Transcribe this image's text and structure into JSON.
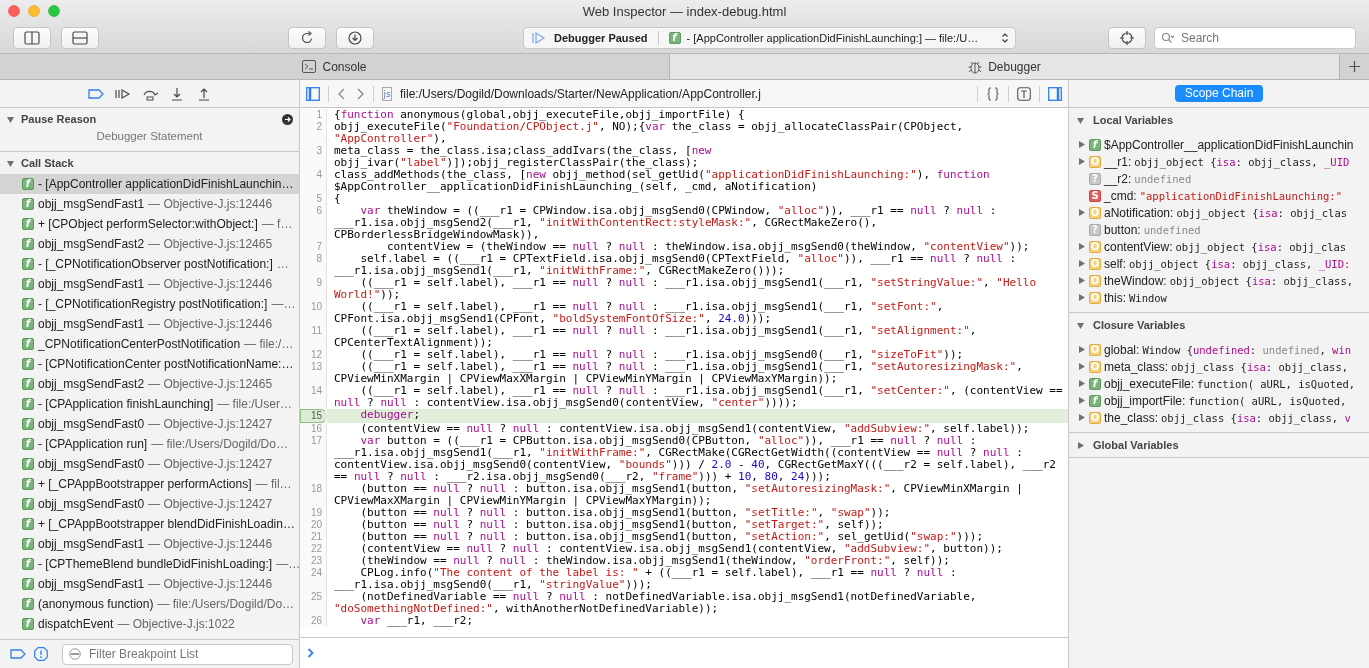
{
  "window": {
    "title": "Web Inspector — index-debug.html"
  },
  "toolbar": {
    "status": "Debugger Paused",
    "frame_icon": "f",
    "frame": "- [AppController applicationDidFinishLaunching:] — file:/U…",
    "search": {
      "placeholder": "Search"
    }
  },
  "tabs": [
    {
      "label": "Console",
      "kind": "console",
      "selected": false
    },
    {
      "label": "Debugger",
      "kind": "debugger",
      "selected": true
    }
  ],
  "sidebar": {
    "sections": [
      {
        "title": "Pause Reason",
        "kind": "reason",
        "expanded": true,
        "text": "Debugger Statement"
      },
      {
        "title": "Call Stack",
        "kind": "stack",
        "expanded": true,
        "items": [
          {
            "icon": "f",
            "name": "- [AppController applicationDidFinishLaunchin…",
            "selected": true
          },
          {
            "icon": "f",
            "name": "objj_msgSendFast1",
            "location": "— Objective-J.js:12446",
            "selected": false
          },
          {
            "icon": "f",
            "name": "+ [CPObject performSelector:withObject:]",
            "location": "— f…",
            "selected": false
          },
          {
            "icon": "f",
            "name": "objj_msgSendFast2",
            "location": "— Objective-J.js:12465",
            "selected": false
          },
          {
            "icon": "f",
            "name": "- [_CPNotificationObserver postNotification:]",
            "location": "…",
            "selected": false
          },
          {
            "icon": "f",
            "name": "objj_msgSendFast1",
            "location": "— Objective-J.js:12446",
            "selected": false
          },
          {
            "icon": "f",
            "name": "- [_CPNotificationRegistry postNotification:]",
            "location": "—…",
            "selected": false
          },
          {
            "icon": "f",
            "name": "objj_msgSendFast1",
            "location": "— Objective-J.js:12446",
            "selected": false
          },
          {
            "icon": "f",
            "name": "_CPNotificationCenterPostNotification",
            "location": "— file:/…",
            "selected": false
          },
          {
            "icon": "f",
            "name": "- [CPNotificationCenter postNotificationName:…",
            "selected": false
          },
          {
            "icon": "f",
            "name": "objj_msgSendFast2",
            "location": "— Objective-J.js:12465",
            "selected": false
          },
          {
            "icon": "f",
            "name": "- [CPApplication finishLaunching]",
            "location": "— file:/User…",
            "selected": false
          },
          {
            "icon": "f",
            "name": "objj_msgSendFast0",
            "location": "— Objective-J.js:12427",
            "selected": false
          },
          {
            "icon": "f",
            "name": "- [CPApplication run]",
            "location": "— file:/Users/Dogild/Do…",
            "selected": false
          },
          {
            "icon": "f",
            "name": "objj_msgSendFast0",
            "location": "— Objective-J.js:12427",
            "selected": false
          },
          {
            "icon": "f",
            "name": "+ [_CPAppBootstrapper performActions]",
            "location": "— fil…",
            "selected": false
          },
          {
            "icon": "f",
            "name": "objj_msgSendFast0",
            "location": "— Objective-J.js:12427",
            "selected": false
          },
          {
            "icon": "f",
            "name": "+ [_CPAppBootstrapper blendDidFinishLoadin…",
            "selected": false
          },
          {
            "icon": "f",
            "name": "objj_msgSendFast1",
            "location": "— Objective-J.js:12446",
            "selected": false
          },
          {
            "icon": "f",
            "name": "- [CPThemeBlend bundleDidFinishLoading:]",
            "location": "—…",
            "selected": false
          },
          {
            "icon": "f",
            "name": "objj_msgSendFast1",
            "location": "— Objective-J.js:12446",
            "selected": false
          },
          {
            "icon": "f",
            "name": "(anonymous function)",
            "location": "— file:/Users/Dogild/Do…",
            "selected": false
          },
          {
            "icon": "f",
            "name": "dispatchEvent",
            "location": "— Objective-J.js:1022",
            "selected": false
          }
        ]
      }
    ],
    "filter": {
      "placeholder": "Filter Breakpoint List"
    }
  },
  "editor": {
    "path": "file:/Users/Dogild/Downloads/Starter/NewApplication/AppController.j",
    "file_icon": "js",
    "lines": [
      {
        "number": "1",
        "current": false,
        "tokens": [
          {
            "kind": "plain",
            "text": "{"
          },
          {
            "kind": "keyword",
            "text": "function"
          },
          {
            "kind": "plain",
            "text": " anonymous(global,objj_executeFile,objj_importFile) {"
          }
        ]
      },
      {
        "number": "2",
        "current": false,
        "tokens": [
          {
            "kind": "plain",
            "text": "objj_executeFile("
          },
          {
            "kind": "string",
            "text": "\"Foundation/CPObject.j\""
          },
          {
            "kind": "plain",
            "text": ", NO);{"
          },
          {
            "kind": "keyword",
            "text": "var"
          },
          {
            "kind": "plain",
            "text": " the_class = objj_allocateClassPair(CPObject, "
          },
          {
            "kind": "string",
            "text": "\"AppController\""
          },
          {
            "kind": "plain",
            "text": "),"
          }
        ]
      },
      {
        "number": "3",
        "current": false,
        "tokens": [
          {
            "kind": "plain",
            "text": "meta_class = the_class.isa;class_addIvars(the_class, ["
          },
          {
            "kind": "keyword",
            "text": "new"
          },
          {
            "kind": "plain",
            "text": " objj_ivar("
          },
          {
            "kind": "string",
            "text": "\"label\""
          },
          {
            "kind": "plain",
            "text": ")]);objj_registerClassPair(the_class);"
          }
        ]
      },
      {
        "number": "4",
        "current": false,
        "tokens": [
          {
            "kind": "plain",
            "text": "class_addMethods(the_class, ["
          },
          {
            "kind": "keyword",
            "text": "new"
          },
          {
            "kind": "plain",
            "text": " objj_method(sel_getUid("
          },
          {
            "kind": "string",
            "text": "\"applicationDidFinishLaunching:\""
          },
          {
            "kind": "plain",
            "text": "), "
          },
          {
            "kind": "keyword",
            "text": "function"
          },
          {
            "kind": "plain",
            "text": " $AppController__applicationDidFinishLaunching_(self, _cmd, aNotification)"
          }
        ]
      },
      {
        "number": "5",
        "current": false,
        "tokens": [
          {
            "kind": "plain",
            "text": "{"
          }
        ]
      },
      {
        "number": "6",
        "current": false,
        "tokens": [
          {
            "kind": "keyword",
            "text": "    var"
          },
          {
            "kind": "plain",
            "text": " theWindow = ((___r1 = CPWindow.isa.objj_msgSend0(CPWindow, "
          },
          {
            "kind": "string",
            "text": "\"alloc\""
          },
          {
            "kind": "plain",
            "text": ")), ___r1 == "
          },
          {
            "kind": "keyword",
            "text": "null"
          },
          {
            "kind": "plain",
            "text": " ? "
          },
          {
            "kind": "keyword",
            "text": "null"
          },
          {
            "kind": "plain",
            "text": " : ___r1.isa.objj_msgSend2(___r1, "
          },
          {
            "kind": "string",
            "text": "\"initWithContentRect:styleMask:\""
          },
          {
            "kind": "plain",
            "text": ", CGRectMakeZero(), CPBorderlessBridgeWindowMask)),"
          }
        ]
      },
      {
        "number": "7",
        "current": false,
        "tokens": [
          {
            "kind": "plain",
            "text": "        contentView = (theWindow == "
          },
          {
            "kind": "keyword",
            "text": "null"
          },
          {
            "kind": "plain",
            "text": " ? "
          },
          {
            "kind": "keyword",
            "text": "null"
          },
          {
            "kind": "plain",
            "text": " : theWindow.isa.objj_msgSend0(theWindow, "
          },
          {
            "kind": "string",
            "text": "\"contentView\""
          },
          {
            "kind": "plain",
            "text": "));"
          }
        ]
      },
      {
        "number": "8",
        "current": false,
        "tokens": [
          {
            "kind": "plain",
            "text": "    self.label = ((___r1 = CPTextField.isa.objj_msgSend0(CPTextField, "
          },
          {
            "kind": "string",
            "text": "\"alloc\""
          },
          {
            "kind": "plain",
            "text": ")), ___r1 == "
          },
          {
            "kind": "keyword",
            "text": "null"
          },
          {
            "kind": "plain",
            "text": " ? "
          },
          {
            "kind": "keyword",
            "text": "null"
          },
          {
            "kind": "plain",
            "text": " : ___r1.isa.objj_msgSend1(___r1, "
          },
          {
            "kind": "string",
            "text": "\"initWithFrame:\""
          },
          {
            "kind": "plain",
            "text": ", CGRectMakeZero()));"
          }
        ]
      },
      {
        "number": "9",
        "current": false,
        "tokens": [
          {
            "kind": "plain",
            "text": "    ((___r1 = self.label), ___r1 == "
          },
          {
            "kind": "keyword",
            "text": "null"
          },
          {
            "kind": "plain",
            "text": " ? "
          },
          {
            "kind": "keyword",
            "text": "null"
          },
          {
            "kind": "plain",
            "text": " : ___r1.isa.objj_msgSend1(___r1, "
          },
          {
            "kind": "string",
            "text": "\"setStringValue:\""
          },
          {
            "kind": "plain",
            "text": ", "
          },
          {
            "kind": "string",
            "text": "\"Hello World!\""
          },
          {
            "kind": "plain",
            "text": "));"
          }
        ]
      },
      {
        "number": "10",
        "current": false,
        "tokens": [
          {
            "kind": "plain",
            "text": "    ((___r1 = self.label), ___r1 == "
          },
          {
            "kind": "keyword",
            "text": "null"
          },
          {
            "kind": "plain",
            "text": " ? "
          },
          {
            "kind": "keyword",
            "text": "null"
          },
          {
            "kind": "plain",
            "text": " : ___r1.isa.objj_msgSend1(___r1, "
          },
          {
            "kind": "string",
            "text": "\"setFont:\""
          },
          {
            "kind": "plain",
            "text": ", CPFont.isa.objj_msgSend1(CPFont, "
          },
          {
            "kind": "string",
            "text": "\"boldSystemFontOfSize:\""
          },
          {
            "kind": "plain",
            "text": ", "
          },
          {
            "kind": "number",
            "text": "24.0"
          },
          {
            "kind": "plain",
            "text": ")));"
          }
        ]
      },
      {
        "number": "11",
        "current": false,
        "tokens": [
          {
            "kind": "plain",
            "text": "    ((___r1 = self.label), ___r1 == "
          },
          {
            "kind": "keyword",
            "text": "null"
          },
          {
            "kind": "plain",
            "text": " ? "
          },
          {
            "kind": "keyword",
            "text": "null"
          },
          {
            "kind": "plain",
            "text": " : ___r1.isa.objj_msgSend1(___r1, "
          },
          {
            "kind": "string",
            "text": "\"setAlignment:\""
          },
          {
            "kind": "plain",
            "text": ", CPCenterTextAlignment));"
          }
        ]
      },
      {
        "number": "12",
        "current": false,
        "tokens": [
          {
            "kind": "plain",
            "text": "    ((___r1 = self.label), ___r1 == "
          },
          {
            "kind": "keyword",
            "text": "null"
          },
          {
            "kind": "plain",
            "text": " ? "
          },
          {
            "kind": "keyword",
            "text": "null"
          },
          {
            "kind": "plain",
            "text": " : ___r1.isa.objj_msgSend0(___r1, "
          },
          {
            "kind": "string",
            "text": "\"sizeToFit\""
          },
          {
            "kind": "plain",
            "text": "));"
          }
        ]
      },
      {
        "number": "13",
        "current": false,
        "tokens": [
          {
            "kind": "plain",
            "text": "    ((___r1 = self.label), ___r1 == "
          },
          {
            "kind": "keyword",
            "text": "null"
          },
          {
            "kind": "plain",
            "text": " ? "
          },
          {
            "kind": "keyword",
            "text": "null"
          },
          {
            "kind": "plain",
            "text": " : ___r1.isa.objj_msgSend1(___r1, "
          },
          {
            "kind": "string",
            "text": "\"setAutoresizingMask:\""
          },
          {
            "kind": "plain",
            "text": ", CPViewMinXMargin | CPViewMaxXMargin | CPViewMinYMargin | CPViewMaxYMargin));"
          }
        ]
      },
      {
        "number": "14",
        "current": false,
        "tokens": [
          {
            "kind": "plain",
            "text": "    ((___r1 = self.label), ___r1 == "
          },
          {
            "kind": "keyword",
            "text": "null"
          },
          {
            "kind": "plain",
            "text": " ? "
          },
          {
            "kind": "keyword",
            "text": "null"
          },
          {
            "kind": "plain",
            "text": " : ___r1.isa.objj_msgSend1(___r1, "
          },
          {
            "kind": "string",
            "text": "\"setCenter:\""
          },
          {
            "kind": "plain",
            "text": ", (contentView == "
          },
          {
            "kind": "keyword",
            "text": "null"
          },
          {
            "kind": "plain",
            "text": " ? "
          },
          {
            "kind": "keyword",
            "text": "null"
          },
          {
            "kind": "plain",
            "text": " : contentView.isa.objj_msgSend0(contentView, "
          },
          {
            "kind": "string",
            "text": "\"center\""
          },
          {
            "kind": "plain",
            "text": "))));"
          }
        ]
      },
      {
        "number": "15",
        "current": true,
        "tokens": [
          {
            "kind": "keyword",
            "text": "    debugger"
          },
          {
            "kind": "plain",
            "text": ";"
          }
        ]
      },
      {
        "number": "16",
        "current": false,
        "tokens": [
          {
            "kind": "plain",
            "text": "    (contentView == "
          },
          {
            "kind": "keyword",
            "text": "null"
          },
          {
            "kind": "plain",
            "text": " ? "
          },
          {
            "kind": "keyword",
            "text": "null"
          },
          {
            "kind": "plain",
            "text": " : contentView.isa.objj_msgSend1(contentView, "
          },
          {
            "kind": "string",
            "text": "\"addSubview:\""
          },
          {
            "kind": "plain",
            "text": ", self.label));"
          }
        ]
      },
      {
        "number": "17",
        "current": false,
        "tokens": [
          {
            "kind": "keyword",
            "text": "    var"
          },
          {
            "kind": "plain",
            "text": " button = ((___r1 = CPButton.isa.objj_msgSend0(CPButton, "
          },
          {
            "kind": "string",
            "text": "\"alloc\""
          },
          {
            "kind": "plain",
            "text": ")), ___r1 == "
          },
          {
            "kind": "keyword",
            "text": "null"
          },
          {
            "kind": "plain",
            "text": " ? "
          },
          {
            "kind": "keyword",
            "text": "null"
          },
          {
            "kind": "plain",
            "text": " : ___r1.isa.objj_msgSend1(___r1, "
          },
          {
            "kind": "string",
            "text": "\"initWithFrame:\""
          },
          {
            "kind": "plain",
            "text": ", CGRectMake(CGRectGetWidth((contentView == "
          },
          {
            "kind": "keyword",
            "text": "null"
          },
          {
            "kind": "plain",
            "text": " ? "
          },
          {
            "kind": "keyword",
            "text": "null"
          },
          {
            "kind": "plain",
            "text": " : contentView.isa.objj_msgSend0(contentView, "
          },
          {
            "kind": "string",
            "text": "\"bounds\""
          },
          {
            "kind": "plain",
            "text": "))) / "
          },
          {
            "kind": "number",
            "text": "2.0"
          },
          {
            "kind": "plain",
            "text": " - "
          },
          {
            "kind": "number",
            "text": "40"
          },
          {
            "kind": "plain",
            "text": ", CGRectGetMaxY(((___r2 = self.label), ___r2 == "
          },
          {
            "kind": "keyword",
            "text": "null"
          },
          {
            "kind": "plain",
            "text": " ? "
          },
          {
            "kind": "keyword",
            "text": "null"
          },
          {
            "kind": "plain",
            "text": " : ___r2.isa.objj_msgSend0(___r2, "
          },
          {
            "kind": "string",
            "text": "\"frame\""
          },
          {
            "kind": "plain",
            "text": "))) + "
          },
          {
            "kind": "number",
            "text": "10"
          },
          {
            "kind": "plain",
            "text": ", "
          },
          {
            "kind": "number",
            "text": "80"
          },
          {
            "kind": "plain",
            "text": ", "
          },
          {
            "kind": "number",
            "text": "24"
          },
          {
            "kind": "plain",
            "text": ")));"
          }
        ]
      },
      {
        "number": "18",
        "current": false,
        "tokens": [
          {
            "kind": "plain",
            "text": "    (button == "
          },
          {
            "kind": "keyword",
            "text": "null"
          },
          {
            "kind": "plain",
            "text": " ? "
          },
          {
            "kind": "keyword",
            "text": "null"
          },
          {
            "kind": "plain",
            "text": " : button.isa.objj_msgSend1(button, "
          },
          {
            "kind": "string",
            "text": "\"setAutoresizingMask:\""
          },
          {
            "kind": "plain",
            "text": ", CPViewMinXMargin | CPViewMaxXMargin | CPViewMinYMargin | CPViewMaxYMargin));"
          }
        ]
      },
      {
        "number": "19",
        "current": false,
        "tokens": [
          {
            "kind": "plain",
            "text": "    (button == "
          },
          {
            "kind": "keyword",
            "text": "null"
          },
          {
            "kind": "plain",
            "text": " ? "
          },
          {
            "kind": "keyword",
            "text": "null"
          },
          {
            "kind": "plain",
            "text": " : button.isa.objj_msgSend1(button, "
          },
          {
            "kind": "string",
            "text": "\"setTitle:\""
          },
          {
            "kind": "plain",
            "text": ", "
          },
          {
            "kind": "string",
            "text": "\"swap\""
          },
          {
            "kind": "plain",
            "text": "));"
          }
        ]
      },
      {
        "number": "20",
        "current": false,
        "tokens": [
          {
            "kind": "plain",
            "text": "    (button == "
          },
          {
            "kind": "keyword",
            "text": "null"
          },
          {
            "kind": "plain",
            "text": " ? "
          },
          {
            "kind": "keyword",
            "text": "null"
          },
          {
            "kind": "plain",
            "text": " : button.isa.objj_msgSend1(button, "
          },
          {
            "kind": "string",
            "text": "\"setTarget:\""
          },
          {
            "kind": "plain",
            "text": ", self));"
          }
        ]
      },
      {
        "number": "21",
        "current": false,
        "tokens": [
          {
            "kind": "plain",
            "text": "    (button == "
          },
          {
            "kind": "keyword",
            "text": "null"
          },
          {
            "kind": "plain",
            "text": " ? "
          },
          {
            "kind": "keyword",
            "text": "null"
          },
          {
            "kind": "plain",
            "text": " : button.isa.objj_msgSend1(button, "
          },
          {
            "kind": "string",
            "text": "\"setAction:\""
          },
          {
            "kind": "plain",
            "text": ", sel_getUid("
          },
          {
            "kind": "string",
            "text": "\"swap:\""
          },
          {
            "kind": "plain",
            "text": ")));"
          }
        ]
      },
      {
        "number": "22",
        "current": false,
        "tokens": [
          {
            "kind": "plain",
            "text": "    (contentView == "
          },
          {
            "kind": "keyword",
            "text": "null"
          },
          {
            "kind": "plain",
            "text": " ? "
          },
          {
            "kind": "keyword",
            "text": "null"
          },
          {
            "kind": "plain",
            "text": " : contentView.isa.objj_msgSend1(contentView, "
          },
          {
            "kind": "string",
            "text": "\"addSubview:\""
          },
          {
            "kind": "plain",
            "text": ", button));"
          }
        ]
      },
      {
        "number": "23",
        "current": false,
        "tokens": [
          {
            "kind": "plain",
            "text": "    (theWindow == "
          },
          {
            "kind": "keyword",
            "text": "null"
          },
          {
            "kind": "plain",
            "text": " ? "
          },
          {
            "kind": "keyword",
            "text": "null"
          },
          {
            "kind": "plain",
            "text": " : theWindow.isa.objj_msgSend1(theWindow, "
          },
          {
            "kind": "string",
            "text": "\"orderFront:\""
          },
          {
            "kind": "plain",
            "text": ", self));"
          }
        ]
      },
      {
        "number": "24",
        "current": false,
        "tokens": [
          {
            "kind": "plain",
            "text": "    CPLog.info("
          },
          {
            "kind": "string",
            "text": "\"The content of the label is: \""
          },
          {
            "kind": "plain",
            "text": " + ((___r1 = self.label), ___r1 == "
          },
          {
            "kind": "keyword",
            "text": "null"
          },
          {
            "kind": "plain",
            "text": " ? "
          },
          {
            "kind": "keyword",
            "text": "null"
          },
          {
            "kind": "plain",
            "text": " : ___r1.isa.objj_msgSend0(___r1, "
          },
          {
            "kind": "string",
            "text": "\"stringValue\""
          },
          {
            "kind": "plain",
            "text": ")));"
          }
        ]
      },
      {
        "number": "25",
        "current": false,
        "tokens": [
          {
            "kind": "plain",
            "text": "    (notDefinedVariable == "
          },
          {
            "kind": "keyword",
            "text": "null"
          },
          {
            "kind": "plain",
            "text": " ? "
          },
          {
            "kind": "keyword",
            "text": "null"
          },
          {
            "kind": "plain",
            "text": " : notDefinedVariable.isa.objj_msgSend1(notDefinedVariable, "
          },
          {
            "kind": "string",
            "text": "\"doSomethingNotDefined:\""
          },
          {
            "kind": "plain",
            "text": ", withAnotherNotDefinedVariable));"
          }
        ]
      },
      {
        "number": "26",
        "current": false,
        "tokens": [
          {
            "kind": "keyword",
            "text": "    var"
          },
          {
            "kind": "plain",
            "text": " ___r1, ___r2;"
          }
        ]
      }
    ]
  },
  "details": {
    "button": "Scope Chain",
    "sections": [
      {
        "title": "Local Variables",
        "expanded": true,
        "items": [
          {
            "kind": "function",
            "icon": "f",
            "expandable": true,
            "name": "$AppController__applicationDidFinishLaunchin"
          },
          {
            "kind": "object",
            "icon": "O",
            "expandable": true,
            "name": "__r1:",
            "value": [
              {
                "kind": "plain",
                "text": "objj_object {"
              },
              {
                "kind": "keyword",
                "text": "isa"
              },
              {
                "kind": "plain",
                "text": ": objj_class, "
              },
              {
                "kind": "keyword",
                "text": "_UID"
              }
            ]
          },
          {
            "kind": "undefined",
            "icon": "?",
            "expandable": false,
            "name": "__r2:",
            "value": [
              {
                "kind": "muted",
                "text": "undefined"
              }
            ]
          },
          {
            "kind": "string",
            "icon": "S",
            "expandable": false,
            "name": "_cmd:",
            "value": [
              {
                "kind": "string",
                "text": "\"applicationDidFinishLaunching:\""
              }
            ]
          },
          {
            "kind": "object",
            "icon": "O",
            "expandable": true,
            "name": "aNotification:",
            "value": [
              {
                "kind": "plain",
                "text": "objj_object {"
              },
              {
                "kind": "keyword",
                "text": "isa"
              },
              {
                "kind": "plain",
                "text": ": objj_clas"
              }
            ]
          },
          {
            "kind": "undefined",
            "icon": "?",
            "expandable": false,
            "name": "button:",
            "value": [
              {
                "kind": "muted",
                "text": "undefined"
              }
            ]
          },
          {
            "kind": "object",
            "icon": "O",
            "expandable": true,
            "name": "contentView:",
            "value": [
              {
                "kind": "plain",
                "text": "objj_object {"
              },
              {
                "kind": "keyword",
                "text": "isa"
              },
              {
                "kind": "plain",
                "text": ": objj_clas"
              }
            ]
          },
          {
            "kind": "object",
            "icon": "O",
            "expandable": true,
            "name": "self:",
            "value": [
              {
                "kind": "plain",
                "text": "objj_object {"
              },
              {
                "kind": "keyword",
                "text": "isa"
              },
              {
                "kind": "plain",
                "text": ": objj_class, "
              },
              {
                "kind": "keyword",
                "text": "_UID:"
              }
            ]
          },
          {
            "kind": "object",
            "icon": "O",
            "expandable": true,
            "name": "theWindow:",
            "value": [
              {
                "kind": "plain",
                "text": "objj_object {"
              },
              {
                "kind": "keyword",
                "text": "isa"
              },
              {
                "kind": "plain",
                "text": ": objj_class,"
              }
            ]
          },
          {
            "kind": "object",
            "icon": "O",
            "expandable": true,
            "name": "this:",
            "value": [
              {
                "kind": "plain",
                "text": "Window"
              }
            ]
          }
        ]
      },
      {
        "title": "Closure Variables",
        "expanded": true,
        "items": [
          {
            "kind": "object",
            "icon": "O",
            "expandable": true,
            "name": "global:",
            "value": [
              {
                "kind": "plain",
                "text": "Window {"
              },
              {
                "kind": "keyword",
                "text": "undefined"
              },
              {
                "kind": "plain",
                "text": ": "
              },
              {
                "kind": "muted",
                "text": "undefined"
              },
              {
                "kind": "plain",
                "text": ", "
              },
              {
                "kind": "keyword",
                "text": "win"
              }
            ]
          },
          {
            "kind": "object",
            "icon": "O",
            "expandable": true,
            "name": "meta_class:",
            "value": [
              {
                "kind": "plain",
                "text": "objj_class {"
              },
              {
                "kind": "keyword",
                "text": "isa"
              },
              {
                "kind": "plain",
                "text": ": objj_class,"
              }
            ]
          },
          {
            "kind": "function",
            "icon": "f",
            "expandable": true,
            "name": "objj_executeFile:",
            "value": [
              {
                "kind": "plain",
                "text": "function( aURL, isQuoted,"
              }
            ]
          },
          {
            "kind": "function",
            "icon": "f",
            "expandable": true,
            "name": "objj_importFile:",
            "value": [
              {
                "kind": "plain",
                "text": "function( aURL, isQuoted,"
              }
            ]
          },
          {
            "kind": "object",
            "icon": "O",
            "expandable": true,
            "name": "the_class:",
            "value": [
              {
                "kind": "plain",
                "text": "objj_class {"
              },
              {
                "kind": "keyword",
                "text": "isa"
              },
              {
                "kind": "plain",
                "text": ": objj_class, "
              },
              {
                "kind": "keyword",
                "text": "v"
              }
            ]
          }
        ]
      },
      {
        "title": "Global Variables",
        "expanded": false
      }
    ]
  }
}
